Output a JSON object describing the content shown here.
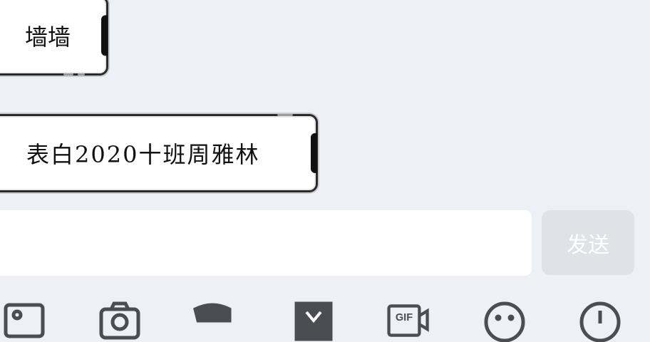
{
  "messages": [
    {
      "text": "墙墙"
    },
    {
      "text": "表白2020十班周雅林"
    }
  ],
  "composer": {
    "input_value": "",
    "send_label": "发送"
  },
  "toolbar": {
    "icons": [
      "image-icon",
      "camera-icon",
      "red-packet-icon",
      "gift-icon",
      "gif-icon",
      "emoji-icon",
      "more-icon"
    ],
    "gif_label": "GIF"
  },
  "colors": {
    "background": "#edf0f4",
    "send_button": "#dfe2e6",
    "icon_stroke": "#4a4d52"
  }
}
